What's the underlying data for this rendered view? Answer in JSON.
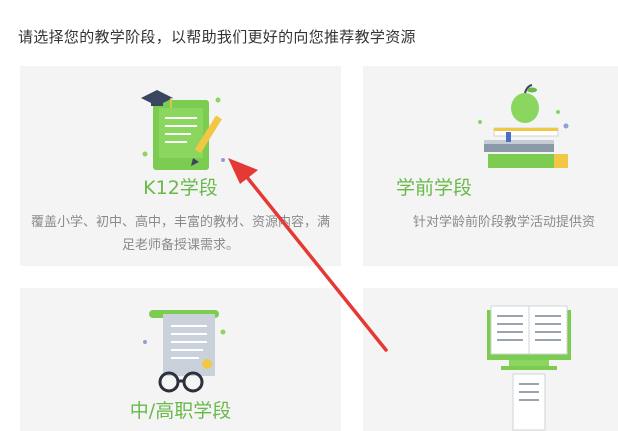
{
  "page": {
    "heading": "请选择您的教学阶段，以帮助我们更好的向您推荐教学资源"
  },
  "cards": [
    {
      "title": "K12学段",
      "description": "覆盖小学、初中、高中，丰富的教材、资源内容，满足老师备授课需求。",
      "icon": "diploma-certificate-icon"
    },
    {
      "title": "学前学段",
      "description": "针对学龄前阶段教学活动提供资",
      "icon": "books-apple-icon"
    },
    {
      "title": "中/高职学段",
      "icon": "scroll-glasses-icon"
    },
    {
      "icon": "open-book-icon"
    }
  ],
  "colors": {
    "accent_green": "#69b94a",
    "card_background": "#f4f4f5",
    "annotation_arrow": "#e53935"
  }
}
